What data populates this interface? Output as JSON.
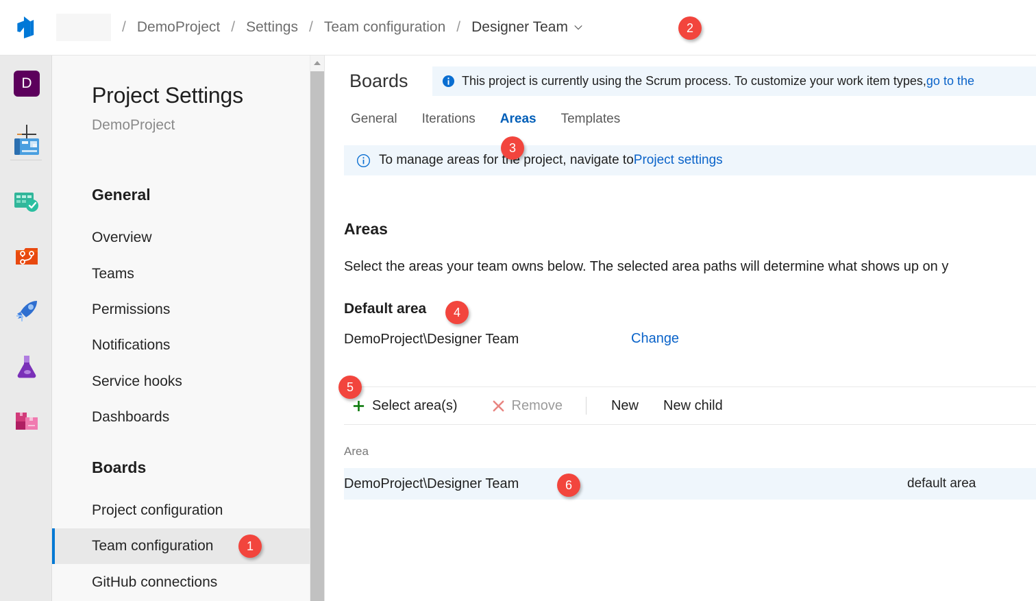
{
  "topbar": {
    "logo_icon": "azure-devops-logo-icon",
    "org_placeholder": "",
    "separator": "/",
    "breadcrumbs": [
      {
        "label": "DemoProject"
      },
      {
        "label": "Settings"
      },
      {
        "label": "Team configuration"
      },
      {
        "label": "Designer Team",
        "has_chevron": true
      }
    ]
  },
  "rail": {
    "avatar_initial": "D",
    "add_icon": "plus-icon",
    "icons": [
      {
        "name": "overview-icon"
      },
      {
        "name": "boards-icon"
      },
      {
        "name": "repos-icon"
      },
      {
        "name": "pipelines-icon"
      },
      {
        "name": "test-plans-icon"
      },
      {
        "name": "artifacts-icon"
      }
    ]
  },
  "sidebar": {
    "title": "Project Settings",
    "subtitle": "DemoProject",
    "groups": [
      {
        "label": "General",
        "items": [
          {
            "label": "Overview"
          },
          {
            "label": "Teams"
          },
          {
            "label": "Permissions"
          },
          {
            "label": "Notifications"
          },
          {
            "label": "Service hooks"
          },
          {
            "label": "Dashboards"
          }
        ]
      },
      {
        "label": "Boards",
        "items": [
          {
            "label": "Project configuration"
          },
          {
            "label": "Team configuration",
            "selected": true
          },
          {
            "label": "GitHub connections"
          }
        ]
      }
    ]
  },
  "main": {
    "section_title": "Boards",
    "banner_top": {
      "icon": "info-filled-icon",
      "text": "This project is currently using the Scrum process. To customize your work item types, ",
      "link": "go to the"
    },
    "tabs": [
      {
        "label": "General",
        "active": false
      },
      {
        "label": "Iterations",
        "active": false
      },
      {
        "label": "Areas",
        "active": true
      },
      {
        "label": "Templates",
        "active": false
      }
    ],
    "banner_sub": {
      "icon": "info-outline-icon",
      "text": "To manage areas for the project, navigate to ",
      "link": "Project settings"
    },
    "areas_heading": "Areas",
    "areas_description": "Select the areas your team owns below. The selected area paths will determine what shows up on y",
    "default_area_heading": "Default area",
    "default_area_value": "DemoProject\\Designer Team",
    "change_link": "Change",
    "toolbar": {
      "select_areas": {
        "label": "Select area(s)",
        "icon": "plus-icon"
      },
      "remove": {
        "label": "Remove",
        "icon": "close-x-icon",
        "disabled": true
      },
      "new": {
        "label": "New"
      },
      "new_child": {
        "label": "New child"
      }
    },
    "grid": {
      "columns": [
        "Area"
      ],
      "rows": [
        {
          "area": "DemoProject\\Designer Team",
          "status": "default area"
        }
      ]
    }
  },
  "badges": [
    {
      "number": "1"
    },
    {
      "number": "2"
    },
    {
      "number": "3"
    },
    {
      "number": "4"
    },
    {
      "number": "5"
    },
    {
      "number": "6"
    }
  ],
  "colors": {
    "badge_red": "#f2453d",
    "accent_blue": "#0078d4",
    "link_blue": "#0a63c9",
    "banner_bg": "#eff6fc",
    "avatar_purple": "#5c005c",
    "green_plus": "#107c10",
    "red_x": "#e8837f"
  }
}
